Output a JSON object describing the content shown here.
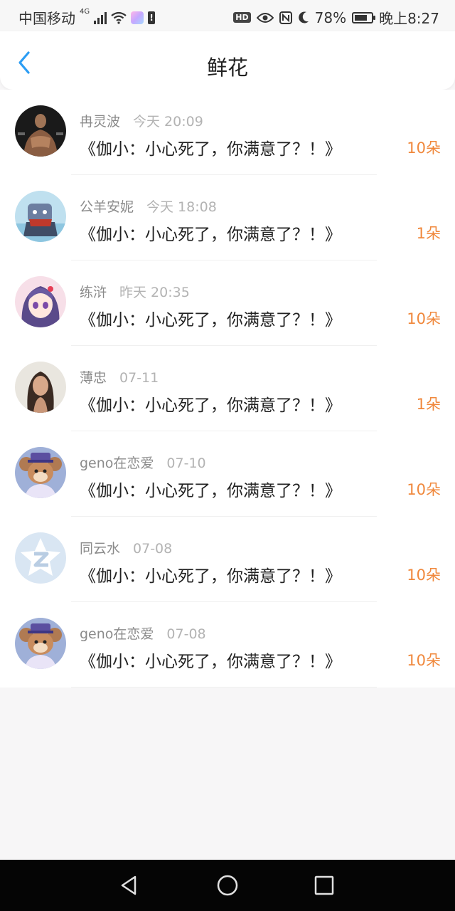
{
  "status_bar": {
    "carrier": "中国移动",
    "network": "4G",
    "battery_percent": "78%",
    "battery_level": 0.78,
    "time": "晚上8:27",
    "hd": "HD"
  },
  "nav": {
    "title": "鲜花"
  },
  "gifts": [
    {
      "name": "冉灵波",
      "time": "今天 20:09",
      "message": "《伽小：小心死了，你满意了？！》",
      "count": "10朵",
      "avatar": "muscle-man-photo"
    },
    {
      "name": "公羊安妮",
      "time": "今天 18:08",
      "message": "《伽小：小心死了，你满意了？！》",
      "count": "1朵",
      "avatar": "anime-character-avatar"
    },
    {
      "name": "练浒",
      "time": "昨天 20:35",
      "message": "《伽小：小心死了，你满意了？！》",
      "count": "10朵",
      "avatar": "anime-girl-avatar"
    },
    {
      "name": "薄忠",
      "time": "07-11",
      "message": "《伽小：小心死了，你满意了？！》",
      "count": "1朵",
      "avatar": "woman-photo"
    },
    {
      "name": "geno在恋爱",
      "time": "07-10",
      "message": "《伽小：小心死了，你满意了？！》",
      "count": "10朵",
      "avatar": "cartoon-mouse-avatar"
    },
    {
      "name": "同云水",
      "time": "07-08",
      "message": "《伽小：小心死了，你满意了？！》",
      "count": "10朵",
      "avatar": "default-z-avatar"
    },
    {
      "name": "geno在恋爱",
      "time": "07-08",
      "message": "《伽小：小心死了，你满意了？！》",
      "count": "10朵",
      "avatar": "cartoon-mouse-avatar"
    }
  ],
  "colors": {
    "accent_blue": "#2b9df4",
    "count_orange": "#f0883c"
  }
}
